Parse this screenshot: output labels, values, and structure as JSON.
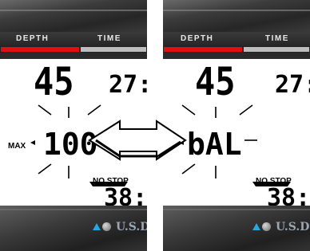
{
  "left_panel": {
    "depth_label": "DEPTH",
    "time_label": "TIME",
    "depth_value": "45",
    "time_value": "27:",
    "max_label": "MAX",
    "max_value": "100",
    "no_stop_label": "NO STOP",
    "no_stop_value": "38:",
    "brand": "U.S.D"
  },
  "right_panel": {
    "depth_label": "DEPTH",
    "time_label": "TIME",
    "depth_value": "45",
    "time_value": "27:",
    "alt_value": "bAL",
    "no_stop_label": "NO STOP",
    "no_stop_value": "38:",
    "brand": "U.S.D"
  },
  "colors": {
    "depth_bar": "#e01010",
    "time_bar": "#bdbdbd",
    "brand_triangle": "#27a6e0"
  }
}
